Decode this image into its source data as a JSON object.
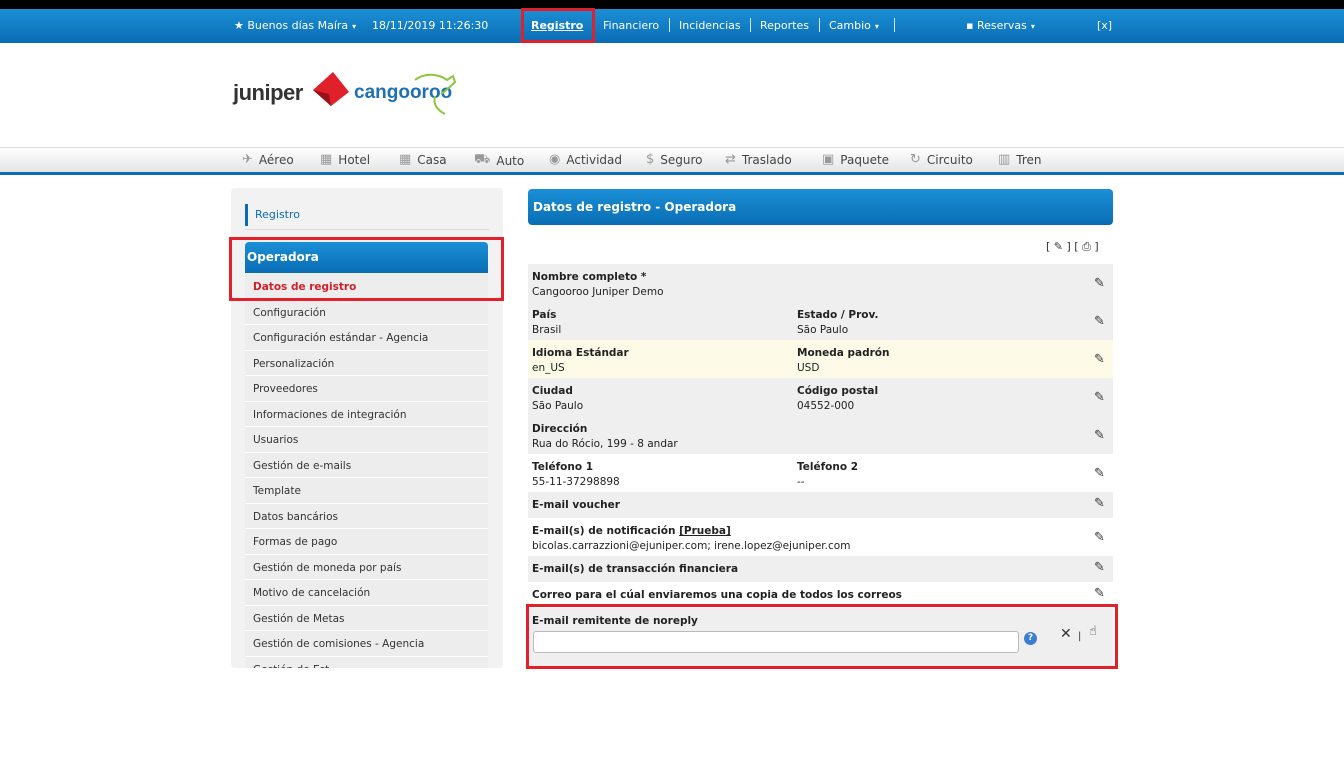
{
  "topbar": {
    "greeting": "Buenos días Maíra",
    "datetime": "18/11/2019 11:26:30",
    "registro": "Registro",
    "financiero": "Financiero",
    "incidencias": "Incidencias",
    "reportes": "Reportes",
    "cambio": "Cambio",
    "reservas": "Reservas",
    "close": "[x]"
  },
  "logo": {
    "juniper": "juniper",
    "cangooroo": "cangooroo"
  },
  "products": [
    {
      "label": "Aéreo",
      "icon": "plane-icon"
    },
    {
      "label": "Hotel",
      "icon": "building-icon"
    },
    {
      "label": "Casa",
      "icon": "house-icon"
    },
    {
      "label": "Auto",
      "icon": "car-icon"
    },
    {
      "label": "Actividad",
      "icon": "activity-icon"
    },
    {
      "label": "Seguro",
      "icon": "dollar-icon"
    },
    {
      "label": "Traslado",
      "icon": "transfer-icon"
    },
    {
      "label": "Paquete",
      "icon": "suitcase-icon"
    },
    {
      "label": "Circuito",
      "icon": "circuit-icon"
    },
    {
      "label": "Tren",
      "icon": "train-icon"
    }
  ],
  "sidebar": {
    "registro": "Registro",
    "section": "Operadora",
    "items": [
      "Datos de registro",
      "Configuración",
      "Configuración estándar - Agencia",
      "Personalización",
      "Proveedores",
      "Informaciones de integración",
      "Usuarios",
      "Gestión de e-mails",
      "Template",
      "Datos bancários",
      "Formas de pago",
      "Gestión de moneda por país",
      "Motivo de cancelación",
      "Gestión de Metas",
      "Gestión de comisiones - Agencia",
      "Gestión de Est..."
    ]
  },
  "main": {
    "title": "Datos de registro - Operadora",
    "tools": "[ ✎ ] [ ⎙ ]",
    "fields": {
      "nombre_label": "Nombre completo *",
      "nombre_value": "Cangooroo Juniper Demo",
      "pais_label": "País",
      "pais_value": "Brasil",
      "estado_label": "Estado / Prov.",
      "estado_value": "São Paulo",
      "idioma_label": "Idioma Estándar",
      "idioma_value": "en_US",
      "moneda_label": "Moneda padrón",
      "moneda_value": "USD",
      "ciudad_label": "Ciudad",
      "ciudad_value": "São Paulo",
      "cp_label": "Código postal",
      "cp_value": "04552-000",
      "direccion_label": "Dirección",
      "direccion_value": "Rua do Rócio, 199 - 8 andar",
      "tel1_label": "Teléfono 1",
      "tel1_value": "55-11-37298898",
      "tel2_label": "Teléfono 2",
      "tel2_value": "--",
      "voucher_label": "E-mail voucher",
      "notif_label": "E-mail(s) de notificación",
      "notif_link": "[Prueba]",
      "notif_value": "bicolas.carrazzioni@ejuniper.com; irene.lopez@ejuniper.com",
      "trans_label": "E-mail(s) de transacción financiera",
      "copia_label": "Correo para el cúal enviaremos una copia de todos los correos",
      "noreply_label": "E-mail remitente de noreply",
      "noreply_value": ""
    }
  }
}
